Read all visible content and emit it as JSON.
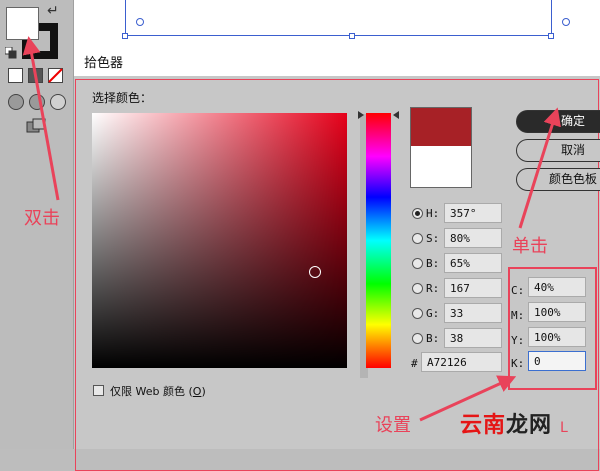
{
  "dialog": {
    "title": "拾色器",
    "select_color_label": "选择颜色：",
    "preview_new_color": "#a72126",
    "preview_old_color": "#ffffff",
    "buttons": {
      "ok": "确定",
      "cancel": "取消",
      "swatches": "颜色色板"
    },
    "hsb_rgb_fields": [
      {
        "key": "H",
        "label": "H:",
        "value": "357°",
        "selected": true
      },
      {
        "key": "S",
        "label": "S:",
        "value": "80%",
        "selected": false
      },
      {
        "key": "B",
        "label": "B:",
        "value": "65%",
        "selected": false
      },
      {
        "key": "R",
        "label": "R:",
        "value": "167",
        "selected": false
      },
      {
        "key": "G",
        "label": "G:",
        "value": "33",
        "selected": false
      },
      {
        "key": "B2",
        "label": "B:",
        "value": "38",
        "selected": false
      }
    ],
    "hex": {
      "label": "#",
      "value": "A72126"
    },
    "cmyk_fields": [
      {
        "key": "C",
        "label": "C:",
        "value": "40%"
      },
      {
        "key": "M",
        "label": "M:",
        "value": "100%"
      },
      {
        "key": "Y",
        "label": "Y:",
        "value": "100%"
      },
      {
        "key": "K",
        "label": "K:",
        "value": "0"
      }
    ],
    "web_only": {
      "label_prefix": "仅限 Web 颜色 (",
      "shortcut": "O",
      "label_suffix": ")",
      "checked": false
    }
  },
  "annotations": {
    "double_click": "双击",
    "single_click": "单击",
    "set": "设置",
    "color": "#e9435a"
  },
  "watermark": {
    "part1": "云南",
    "part2": "龙网",
    "extra": "L"
  },
  "colors": {
    "accent_red": "#e9435a",
    "selection_blue": "#3b5fcf",
    "current_color": "#a72126"
  }
}
